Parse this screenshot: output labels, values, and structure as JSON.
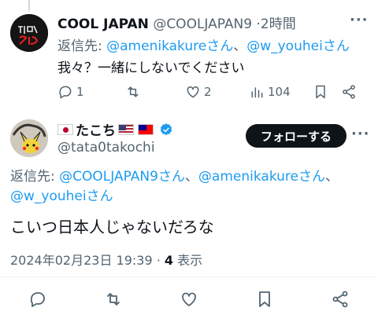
{
  "reply1": {
    "display_name": "COOL JAPAN",
    "handle": "@COOLJAPAN9",
    "separator": "·",
    "time": "2時間",
    "more_label": "···",
    "reply_to_prefix": "返信先: ",
    "reply_to_user1": "@amenikakureさん",
    "reply_to_sep": "、",
    "reply_to_user2": "@w_youheiさん",
    "text": "我々？一緒にしないでください",
    "stats": {
      "replies": "1",
      "likes": "2",
      "views": "104"
    }
  },
  "reply2": {
    "display_name": "たこち",
    "handle": "@tata0takochi",
    "follow_label": "フォローする",
    "more_label": "···",
    "reply_to_prefix": "返信先: ",
    "reply_to_user1": "@COOLJAPAN9さん",
    "reply_to_sep1": "、",
    "reply_to_user2": "@amenikakureさん",
    "reply_to_sep2": "、",
    "reply_to_user3": "@w_youheiさん",
    "text": "こいつ日本人じゃないだろな",
    "timestamp": "2024年02月23日 19:39",
    "meta_sep": " · ",
    "views_count": "4",
    "views_label": " 表示"
  },
  "colors": {
    "link": "#1d9bf0",
    "muted": "#536471",
    "text": "#0f1419",
    "verified": "#1d9bf0"
  },
  "icons": [
    "reply-icon",
    "retweet-icon",
    "like-icon",
    "views-icon",
    "bookmark-icon",
    "share-icon",
    "verified-badge-icon"
  ]
}
